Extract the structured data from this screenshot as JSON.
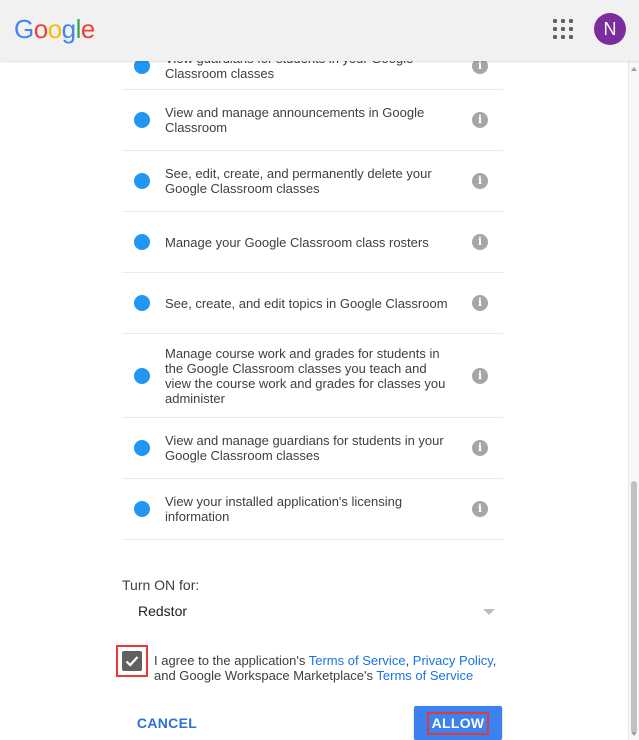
{
  "header": {
    "logo_letters": [
      {
        "ch": "G",
        "color": "#4285F4"
      },
      {
        "ch": "o",
        "color": "#EA4335"
      },
      {
        "ch": "o",
        "color": "#FBBC05"
      },
      {
        "ch": "g",
        "color": "#4285F4"
      },
      {
        "ch": "l",
        "color": "#34A853"
      },
      {
        "ch": "e",
        "color": "#EA4335"
      }
    ],
    "apps_icon": "apps-grid-icon",
    "avatar_initial": "N",
    "avatar_color": "#7B2D9E"
  },
  "permissions": [
    {
      "text": "View guardians for students in your Google Classroom classes",
      "info_icon": "i"
    },
    {
      "text": "View and manage announcements in Google Classroom",
      "info_icon": "i"
    },
    {
      "text": "See, edit, create, and permanently delete your Google Classroom classes",
      "info_icon": "i"
    },
    {
      "text": "Manage your Google Classroom class rosters",
      "info_icon": "i"
    },
    {
      "text": "See, create, and edit topics in Google Classroom",
      "info_icon": "i"
    },
    {
      "text": "Manage course work and grades for students in the Google Classroom classes you teach and view the course work and grades for classes you administer",
      "info_icon": "i"
    },
    {
      "text": "View and manage guardians for students in your Google Classroom classes",
      "info_icon": "i"
    },
    {
      "text": "View your installed application's licensing information",
      "info_icon": "i"
    }
  ],
  "turn_on": {
    "label": "Turn ON for:",
    "selected": "Redstor"
  },
  "agreement": {
    "checked": true,
    "prefix": "I agree to the application's ",
    "tos_link": "Terms of Service",
    "sep": ", ",
    "privacy_link": "Privacy Policy",
    "middle": ", and Google Workspace Marketplace's ",
    "marketplace_tos_link": "Terms of Service"
  },
  "actions": {
    "cancel_label": "CANCEL",
    "allow_label": "ALLOW"
  },
  "colors": {
    "accent": "#1A73E8",
    "bullet": "#2196F3",
    "allow_button": "#3B82F0",
    "highlight_box": "#E53935"
  }
}
